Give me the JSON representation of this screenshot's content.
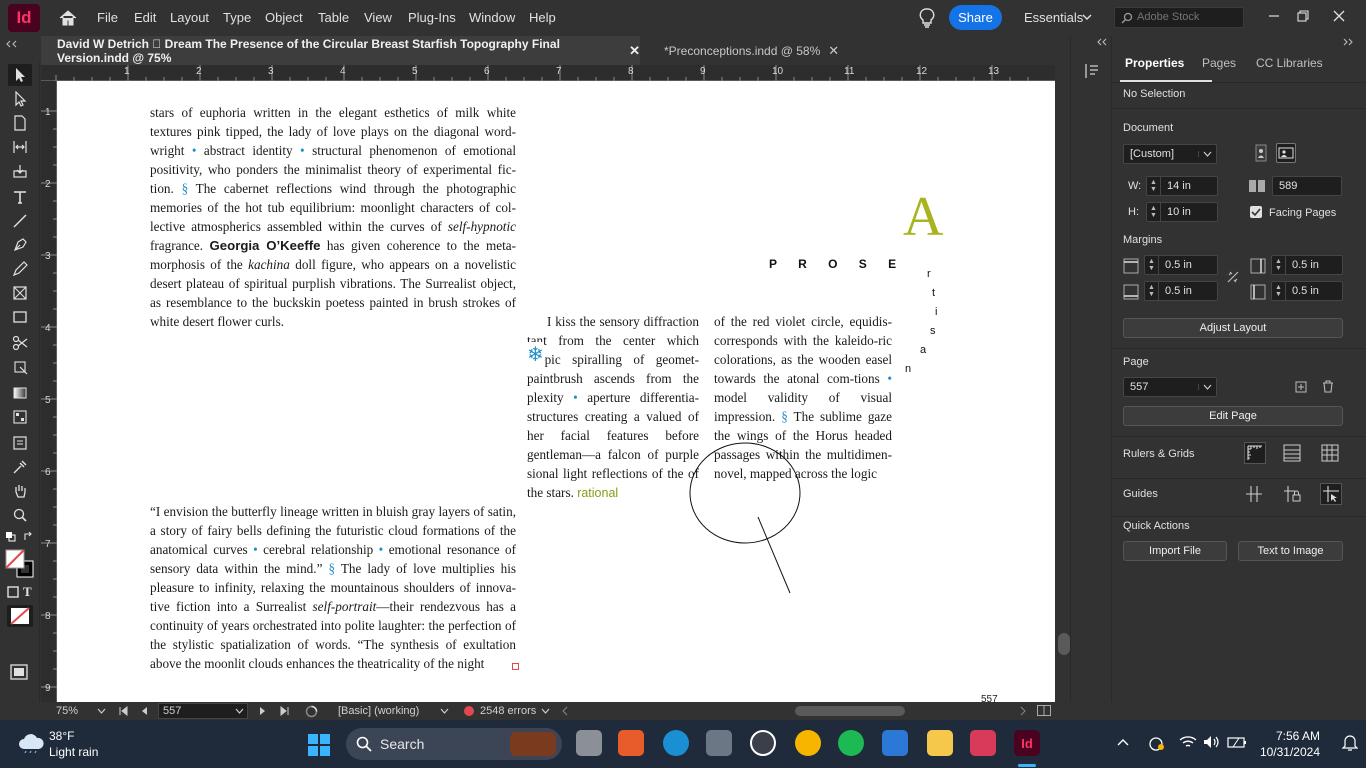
{
  "app": {
    "logo_text": "Id"
  },
  "menu": [
    "File",
    "Edit",
    "Layout",
    "Type",
    "Object",
    "Table",
    "View",
    "Plug-Ins",
    "Window",
    "Help"
  ],
  "share_label": "Share",
  "workspace_label": "Essentials",
  "stock_placeholder": "Adobe Stock",
  "tabs": [
    {
      "label": "David  W  Detrich ￿ Dream The Presence of the Circular Breast Starfish Topography Final Version.indd @ 75%",
      "close": "✕"
    },
    {
      "label": "*Preconceptions.indd @ 58%",
      "close": "✕"
    }
  ],
  "ruler_top": [
    "1",
    "2",
    "3",
    "4",
    "5",
    "6",
    "7",
    "8",
    "9",
    "10",
    "11",
    "12",
    "13"
  ],
  "ruler_left": [
    "1",
    "2",
    "3",
    "4",
    "5",
    "6",
    "7",
    "8",
    "9"
  ],
  "page": {
    "para1_a": "stars of euphoria written in the elegant esthetics of milk white textures pink tipped, the lady of love plays on the diagonal word-wright ",
    "bullet": "•",
    "para1_b": " abstract identity ",
    "para1_c": " structural phenomenon of emotional positivity, who ponders the minimalist theory of experimental fic-tion. ",
    "section": "§",
    "para1_d": " The cabernet reflections wind through the photographic memories of the hot tub equilibrium: moonlight characters of col-lective atmospherics assembled within the curves of ",
    "para1_italic": "self-hypnotic",
    "para1_e": " fragrance. ",
    "para1_bold": "Georgia O’Keeffe",
    "para1_f": " has given coherence to the meta-morphosis of the ",
    "para1_italic2": "kachina",
    "para1_g": " doll figure, who appears on a novelistic desert plateau of spiritual purplish vibrations. The Surrealist object, as resemblance to the buckskin poetess painted in brush strokes of white desert flower curls.",
    "para2_a": "“I envision the butterfly lineage written in bluish gray layers of satin, a story of fairy bells defining the futuristic cloud formations of the anatomical curves ",
    "para2_b": " cerebral relationship ",
    "para2_c": " emotional resonance of sensory data within the mind.” ",
    "para2_d": " The lady of love multiplies his pleasure to infinity, relaxing the mountainous shoulders of innova-tive fiction into a Surrealist ",
    "para2_italic": "self-portrait",
    "para2_e": "—their rendezvous has a continuity of years orchestrated into polite laughter: the perfection of the stylistic spatialization of words. “The synthesis of exultation above the moonlit clouds enhances the theatricality of the night",
    "col1_a": "I kiss the sensory diffraction tant from the center which scopic spiralling of geomet-paintbrush ascends from the plexity ",
    "col1_b": " aperture differentia-structures creating a valued of her facial features before gentleman—a falcon of purple sional light reflections of the of the stars. ",
    "col1_rational": "rational",
    "col2_a": "of the red violet circle, equidis-corresponds with the kaleido-ric colorations, as the wooden easel towards the atonal com-tions ",
    "col2_b": " model validity of visual impression. ",
    "col2_c": " The sublime gaze the wings of the Horus headed passages within the multidimen-novel, mapped across the logic",
    "big_letter": "A",
    "prose": "P R O S E",
    "artisan_letters": [
      "r",
      "t",
      "i",
      "s",
      "a",
      "n"
    ],
    "snowflake": "❄",
    "page_number": "557"
  },
  "properties": {
    "tabs": [
      "Properties",
      "Pages",
      "CC Libraries"
    ],
    "selection": "No Selection",
    "document_label": "Document",
    "preset": "[Custom]",
    "w_label": "W:",
    "w_value": "14 in",
    "h_label": "H:",
    "h_value": "10 in",
    "pages_value": "589",
    "facing_pages": "Facing Pages",
    "margins_label": "Margins",
    "margin_top": "0.5 in",
    "margin_bottom": "0.5 in",
    "margin_left": "0.5 in",
    "margin_right": "0.5 in",
    "adjust_layout": "Adjust Layout",
    "page_label": "Page",
    "page_value": "557",
    "edit_page": "Edit Page",
    "rulers_grids": "Rulers & Grids",
    "guides": "Guides",
    "quick_actions": "Quick Actions",
    "import_file": "Import File",
    "text_to_image": "Text to Image"
  },
  "status": {
    "zoom": "75%",
    "page": "557",
    "style": "[Basic] (working)",
    "errors": "2548 errors"
  },
  "taskbar": {
    "temp": "38°F",
    "weather": "Light rain",
    "search": "Search",
    "time": "7:56 AM",
    "date": "10/31/2024"
  },
  "colors": {
    "accent_blue": "#1473e6",
    "id_brand": "#ff3366",
    "olive": "#8a9a1a",
    "link_blue": "#1f8fc8",
    "error_red": "#e34850"
  }
}
